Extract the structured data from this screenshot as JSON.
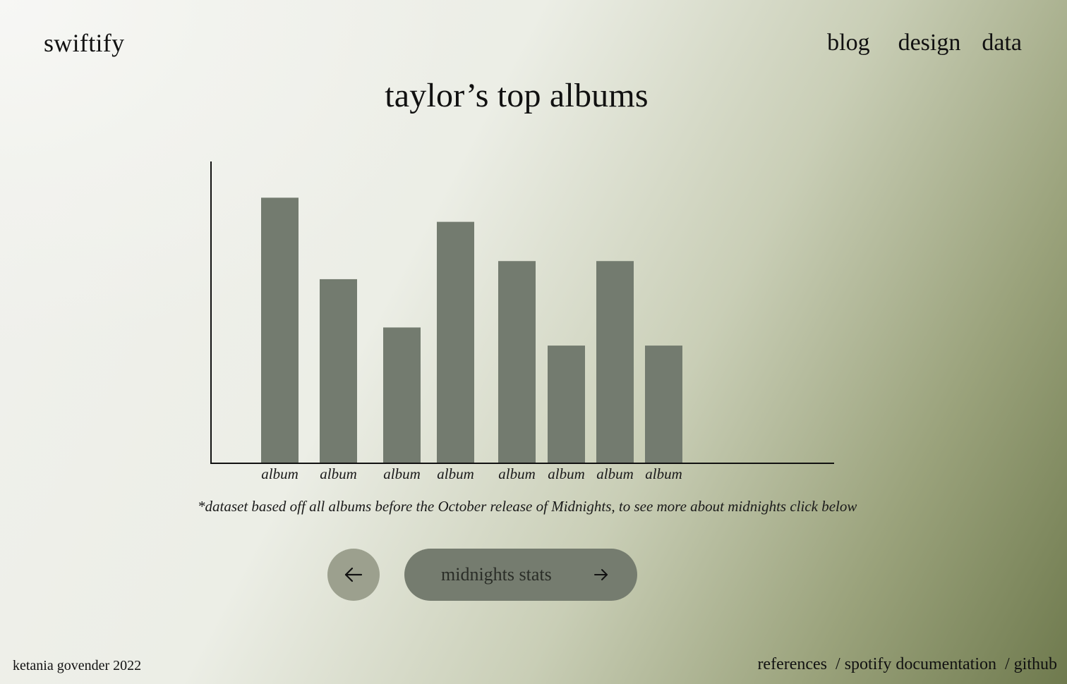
{
  "header": {
    "logo": "swiftify",
    "nav": [
      {
        "label": "blog"
      },
      {
        "label": "design"
      },
      {
        "label": "data"
      }
    ]
  },
  "main": {
    "title": "taylor’s top albums",
    "note": "*dataset based off all albums before the October release of Midnights, to see more about midnights click below",
    "back_button": {
      "icon": "arrow-left-icon"
    },
    "stats_button": {
      "label": "midnights stats",
      "icon": "arrow-right-icon"
    }
  },
  "chart_data": {
    "type": "bar",
    "title": "",
    "xlabel": "",
    "ylabel": "",
    "categories": [
      "album",
      "album",
      "album",
      "album",
      "album",
      "album",
      "album",
      "album"
    ],
    "values": [
      88,
      61,
      45,
      80,
      67,
      39,
      67,
      39
    ],
    "ylim": [
      0,
      100
    ],
    "grid": false,
    "bar_color": "#737b6f"
  },
  "footer": {
    "credit": "ketania govender 2022",
    "links": [
      {
        "label": "references"
      },
      {
        "label": "spotify documentation"
      },
      {
        "label": "github"
      }
    ],
    "separator": "/"
  },
  "colors": {
    "text": "#111111",
    "bar": "#737b6f",
    "button_light": "#9ca08e",
    "button_dark": "#757c6f"
  }
}
